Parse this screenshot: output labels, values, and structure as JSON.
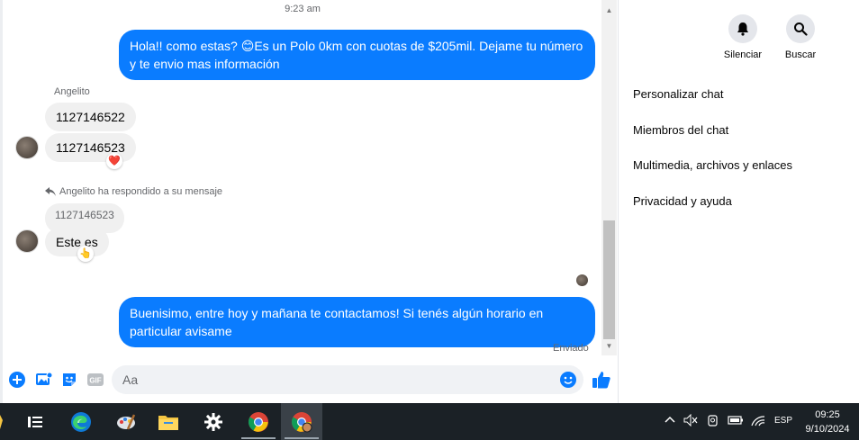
{
  "chat": {
    "timestamp": "9:23 am",
    "outgoing_1": "Hola!! como estas? 😊Es un Polo 0km con cuotas de $205mil. Dejame tu número y te envio mas información",
    "sender_name": "Angelito",
    "incoming_1": "1127146522",
    "incoming_2": "1127146523",
    "reaction_heart": "❤️",
    "reply_note": "Angelito ha respondido a su mensaje",
    "quoted_text": "1127146523",
    "incoming_3": "Este es",
    "reaction_point": "👆",
    "outgoing_2": "Buenisimo, entre hoy y mañana te contactamos! Si tenés algún horario en particular avisame",
    "status": "Enviado"
  },
  "composer": {
    "placeholder": "Aa",
    "icons": [
      "plus-icon",
      "photo-icon",
      "sticker-icon",
      "gif-icon",
      "emoji-icon",
      "like-icon"
    ],
    "gif_label": "GIF"
  },
  "panel": {
    "mute_label": "Silenciar",
    "search_label": "Buscar",
    "menu": [
      "Personalizar chat",
      "Miembros del chat",
      "Multimedia, archivos y enlaces",
      "Privacidad y ayuda"
    ]
  },
  "taskbar": {
    "apps": [
      "task-view-icon",
      "edge-icon",
      "paint-icon",
      "file-explorer-icon",
      "settings-icon",
      "chrome-icon",
      "chrome-profile-icon"
    ],
    "lang": "ESP",
    "time": "09:25",
    "date": "9/10/2024"
  },
  "colors": {
    "messenger_blue": "#0a7cff",
    "bubble_gray": "#f0f0f0",
    "taskbar": "#1b2126"
  }
}
